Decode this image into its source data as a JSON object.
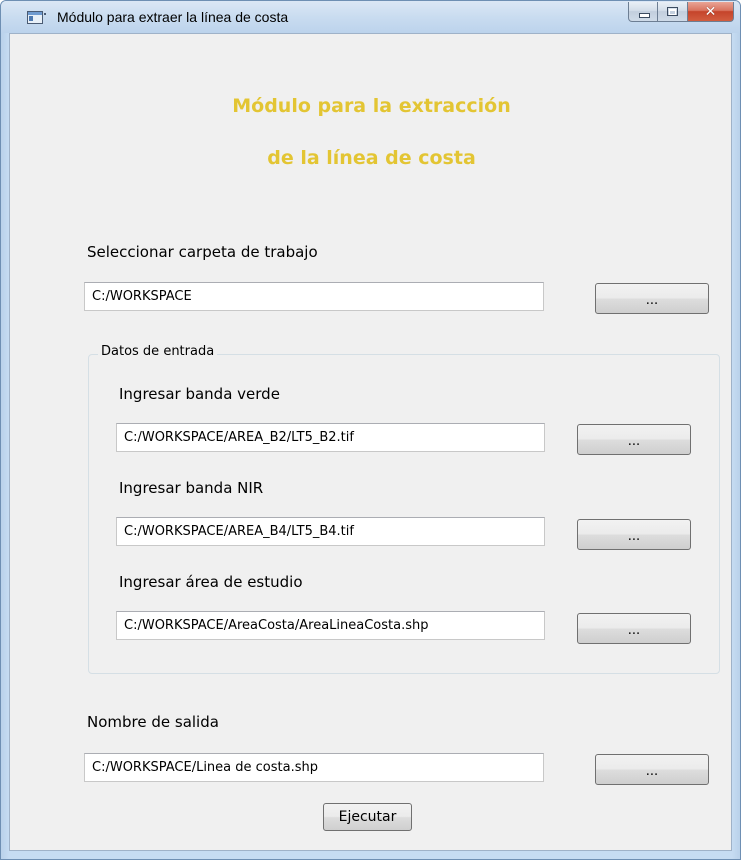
{
  "window": {
    "title": "Módulo para extraer la línea de costa",
    "caption_buttons": {
      "minimize_icon": "minimize-icon",
      "maximize_icon": "maximize-icon",
      "close_icon": "close-icon",
      "close_glyph": "✕"
    }
  },
  "header": {
    "line1": "Módulo para la extracción",
    "line2": "de la línea de costa",
    "color": "#e3c533"
  },
  "workspace": {
    "label": "Seleccionar carpeta de trabajo",
    "value": "C:/WORKSPACE",
    "browse_label": "..."
  },
  "input_group": {
    "title": "Datos de entrada",
    "green_band": {
      "label": "Ingresar banda verde",
      "value": "C:/WORKSPACE/AREA_B2/LT5_B2.tif",
      "browse_label": "..."
    },
    "nir_band": {
      "label": "Ingresar banda NIR",
      "value": "C:/WORKSPACE/AREA_B4/LT5_B4.tif",
      "browse_label": "..."
    },
    "study_area": {
      "label": "Ingresar área de estudio",
      "value": "C:/WORKSPACE/AreaCosta/AreaLineaCosta.shp",
      "browse_label": "..."
    }
  },
  "output": {
    "label": "Nombre de salida",
    "value": "C:/WORKSPACE/Linea de costa.shp",
    "browse_label": "..."
  },
  "actions": {
    "run_label": "Ejecutar"
  }
}
